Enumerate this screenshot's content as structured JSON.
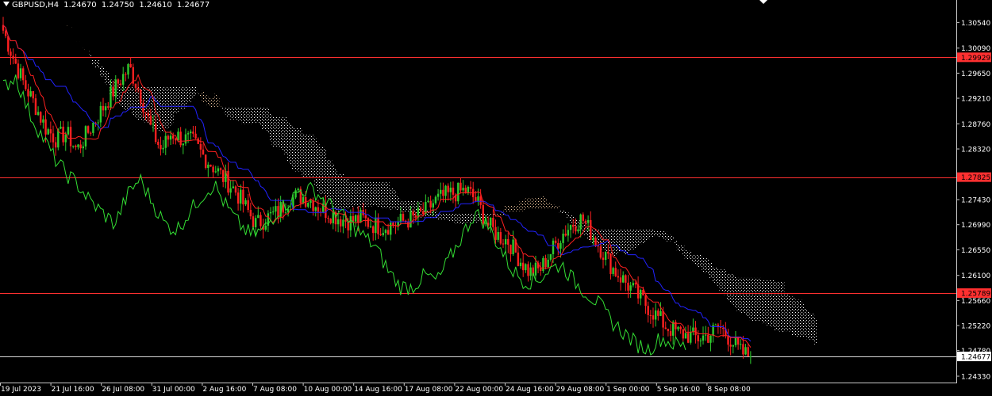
{
  "header": {
    "symbol": "GBPUSD,H4",
    "open": "1.24670",
    "high": "1.24750",
    "low": "1.24610",
    "close": "1.24677"
  },
  "colors": {
    "background": "#000000",
    "bull": "#2ecc2e",
    "bear": "#ff2020",
    "tenkan": "#ff2020",
    "kijun": "#2222ff",
    "chikou": "#33dd33",
    "cloud_up": "#f0c8a0",
    "cloud_down": "#ffffff",
    "hline": "#ff3030",
    "hline_bid": "#d8d8d8"
  },
  "chart_data": {
    "type": "candlestick",
    "ylim": [
      1.2433,
      1.3074
    ],
    "y_ticks": [
      "1.30540",
      "1.30090",
      "1.29650",
      "1.29210",
      "1.28760",
      "1.28320",
      "1.27430",
      "1.26990",
      "1.26550",
      "1.26100",
      "1.25660",
      "1.25220",
      "1.24780",
      "1.24330"
    ],
    "x_ticks": [
      "19 Jul 2023",
      "21 Jul 16:00",
      "26 Jul 08:00",
      "31 Jul 00:00",
      "2 Aug 16:00",
      "7 Aug 08:00",
      "10 Aug 00:00",
      "14 Aug 16:00",
      "17 Aug 08:00",
      "22 Aug 00:00",
      "24 Aug 16:00",
      "29 Aug 08:00",
      "1 Sep 00:00",
      "5 Sep 16:00",
      "8 Sep 08:00"
    ],
    "horizontal_lines": [
      {
        "value": 1.29929,
        "label": "1.29929"
      },
      {
        "value": 1.27825,
        "label": "1.27825"
      },
      {
        "value": 1.25789,
        "label": "1.25789"
      }
    ],
    "bid": {
      "value": 1.24677,
      "label": "1.24677"
    },
    "close_path": [
      1.304,
      1.299,
      1.2945,
      1.291,
      1.287,
      1.285,
      1.286,
      1.283,
      1.286,
      1.289,
      1.292,
      1.295,
      1.2975,
      1.293,
      1.287,
      1.283,
      1.286,
      1.285,
      1.2845,
      1.282,
      1.28,
      1.278,
      1.276,
      1.273,
      1.27,
      1.271,
      1.272,
      1.274,
      1.275,
      1.2745,
      1.273,
      1.272,
      1.271,
      1.2705,
      1.271,
      1.27,
      1.2695,
      1.27,
      1.2705,
      1.271,
      1.272,
      1.274,
      1.275,
      1.2755,
      1.276,
      1.274,
      1.27,
      1.268,
      1.267,
      1.264,
      1.2615,
      1.262,
      1.265,
      1.268,
      1.27,
      1.271,
      1.268,
      1.265,
      1.262,
      1.26,
      1.258,
      1.256,
      1.254,
      1.252,
      1.251,
      1.2505,
      1.25,
      1.2505,
      1.252,
      1.25,
      1.2475,
      1.2468
    ],
    "chikou_path": [
      1.294,
      1.296,
      1.29,
      1.286,
      1.282,
      1.279,
      1.277,
      1.274,
      1.272,
      1.27,
      1.275,
      1.278,
      1.274,
      1.27,
      1.269,
      1.272,
      1.275,
      1.277,
      1.273,
      1.27,
      1.268,
      1.269,
      1.272,
      1.274,
      1.276,
      1.276,
      1.274,
      1.272,
      1.27,
      1.268,
      1.266,
      1.262,
      1.259,
      1.259,
      1.261,
      1.26,
      1.264,
      1.268,
      1.272,
      1.27,
      1.266,
      1.262,
      1.26,
      1.26,
      1.262,
      1.263,
      1.26,
      1.258,
      1.256,
      1.253,
      1.251,
      1.249,
      1.248,
      1.25,
      1.249,
      1.2485
    ]
  }
}
